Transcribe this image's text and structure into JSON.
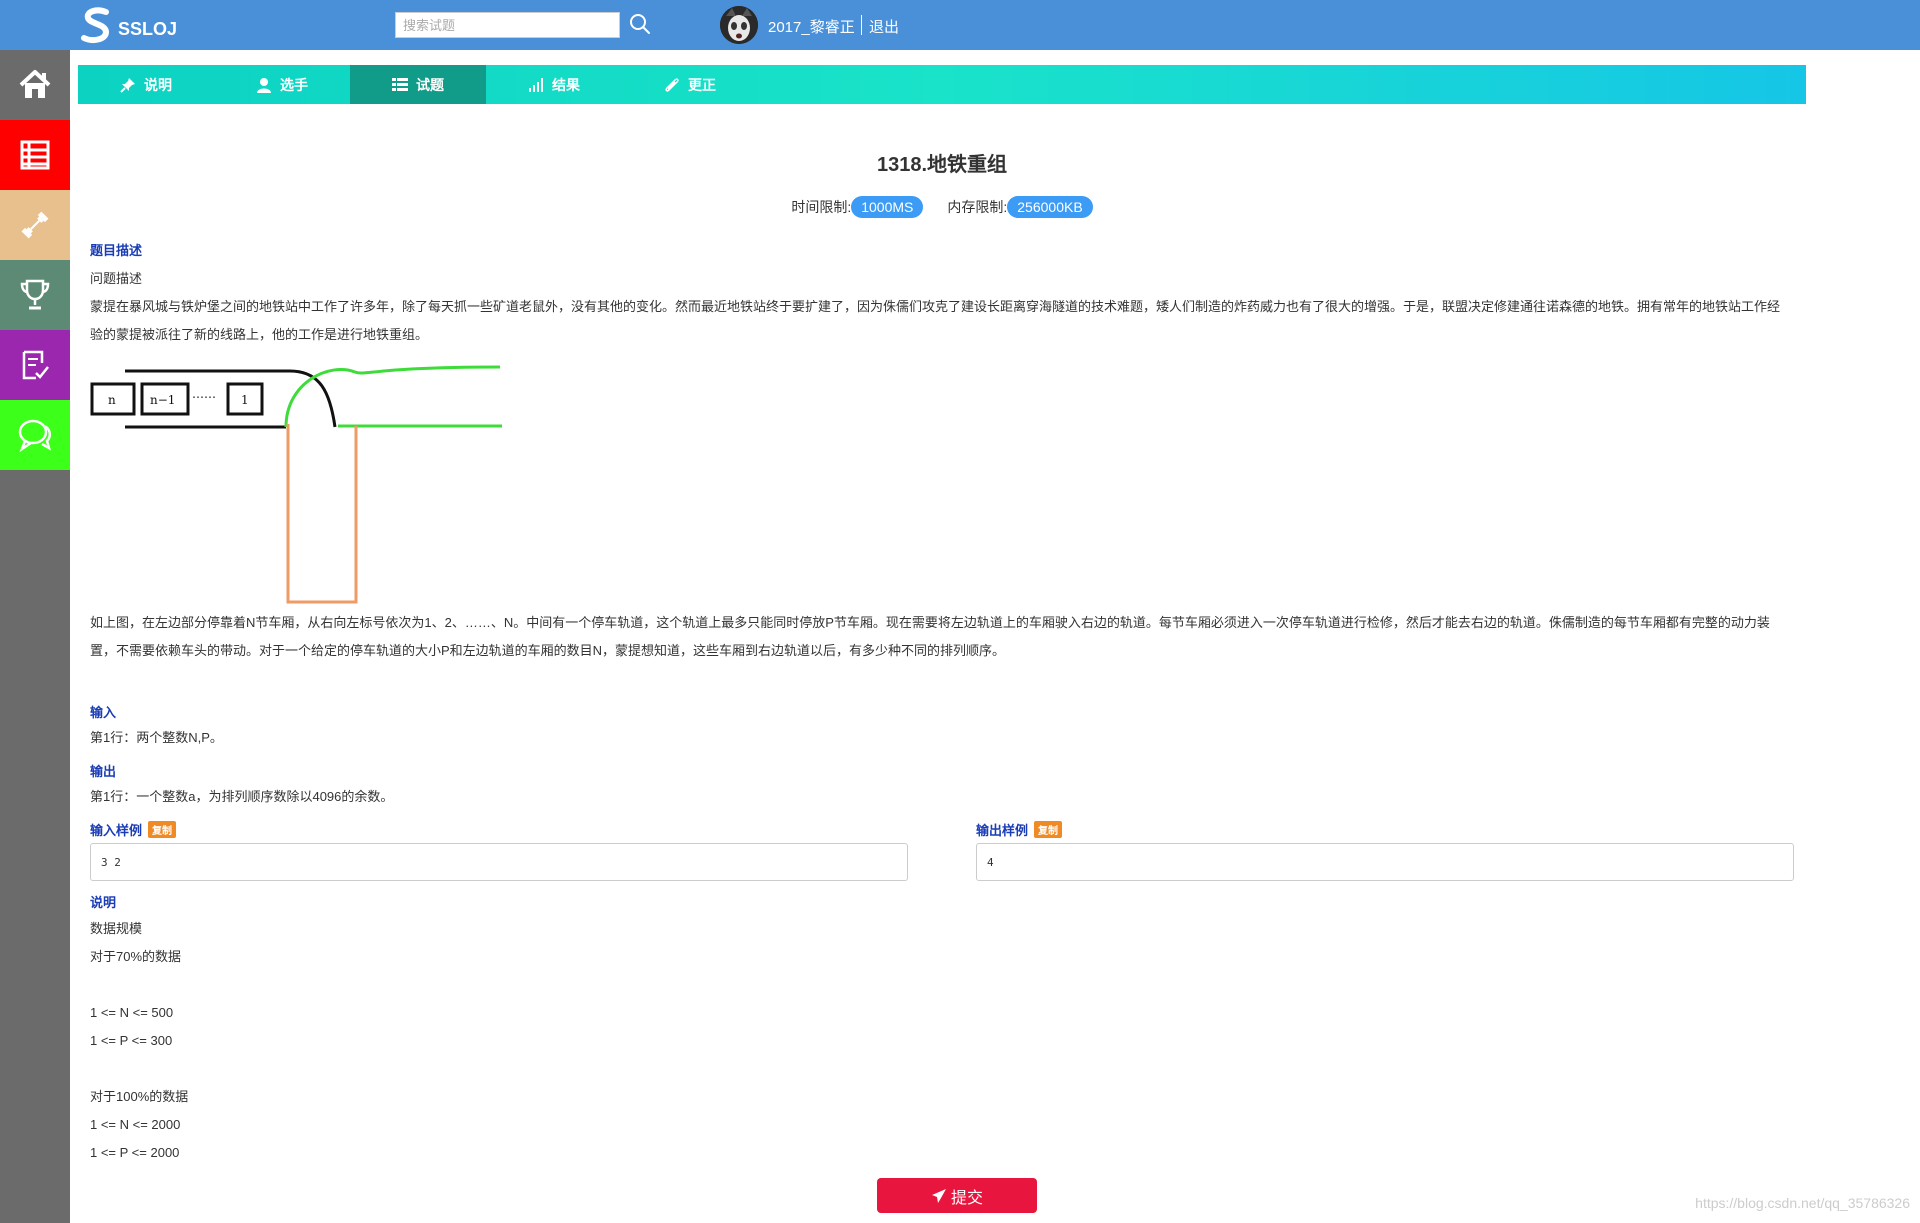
{
  "header": {
    "logo_text": "SSLOJ",
    "search_placeholder": "搜索试题",
    "username": "2017_黎睿正",
    "logout_label": "退出"
  },
  "sidebar": {
    "items": [
      {
        "name": "home",
        "icon": "home-icon",
        "color": "#6b6b6b"
      },
      {
        "name": "problems",
        "icon": "list-icon",
        "color": "#ff0000"
      },
      {
        "name": "training",
        "icon": "dumbbell-icon",
        "color": "#e8c08e"
      },
      {
        "name": "contests",
        "icon": "trophy-icon",
        "color": "#5c8a75"
      },
      {
        "name": "status",
        "icon": "checklist-icon",
        "color": "#9b27af"
      },
      {
        "name": "discuss",
        "icon": "chat-icon",
        "color": "#3cff1a"
      }
    ]
  },
  "tabs": [
    {
      "label": "说明",
      "icon": "pin-icon",
      "active": false
    },
    {
      "label": "选手",
      "icon": "user-icon",
      "active": false
    },
    {
      "label": "试题",
      "icon": "list-icon",
      "active": true
    },
    {
      "label": "结果",
      "icon": "bar-chart-icon",
      "active": false
    },
    {
      "label": "更正",
      "icon": "paperclip-icon",
      "active": false
    }
  ],
  "problem": {
    "title": "1318.地铁重组",
    "time_limit_label": "时间限制:",
    "time_limit": "1000MS",
    "memory_limit_label": "内存限制:",
    "memory_limit": "256000KB",
    "desc_heading": "题目描述",
    "desc_subheading": "问题描述",
    "desc_para1": "蒙提在暴风城与铁炉堡之间的地铁站中工作了许多年，除了每天抓一些矿道老鼠外，没有其他的变化。然而最近地铁站终于要扩建了，因为侏儒们攻克了建设长距离穿海隧道的技术难题，矮人们制造的炸药威力也有了很大的增强。于是，联盟决定修建通往诺森德的地铁。拥有常年的地铁站工作经验的蒙提被派往了新的线路上，他的工作是进行地铁重组。",
    "diagram_labels": {
      "n": "n",
      "n1": "n−1",
      "dots": "……",
      "one": "1"
    },
    "desc_para2": "如上图，在左边部分停靠着N节车厢，从右向左标号依次为1、2、……、N。中间有一个停车轨道，这个轨道上最多只能同时停放P节车厢。现在需要将左边轨道上的车厢驶入右边的轨道。每节车厢必须进入一次停车轨道进行检修，然后才能去右边的轨道。侏儒制造的每节车厢都有完整的动力装置，不需要依赖车头的带动。对于一个给定的停车轨道的大小P和左边轨道的车厢的数目N，蒙提想知道，这些车厢到右边轨道以后，有多少种不同的排列顺序。",
    "input_heading": "输入",
    "input_text": "第1行：两个整数N,P。",
    "output_heading": "输出",
    "output_text": "第1行：一个整数a，为排列顺序数除以4096的余数。",
    "sample_input_heading": "输入样例",
    "sample_output_heading": "输出样例",
    "copy_label": "复制",
    "sample_input": "3 2",
    "sample_output": "4",
    "note_heading": "说明",
    "note_lines": [
      "数据规模",
      "对于70%的数据",
      "1 <= N <= 500",
      "1 <= P <= 300",
      "对于100%的数据",
      "1 <= N <= 2000",
      "1 <= P <= 2000"
    ]
  },
  "submit_label": "提交",
  "watermark": "https://blog.csdn.net/qq_35786326"
}
